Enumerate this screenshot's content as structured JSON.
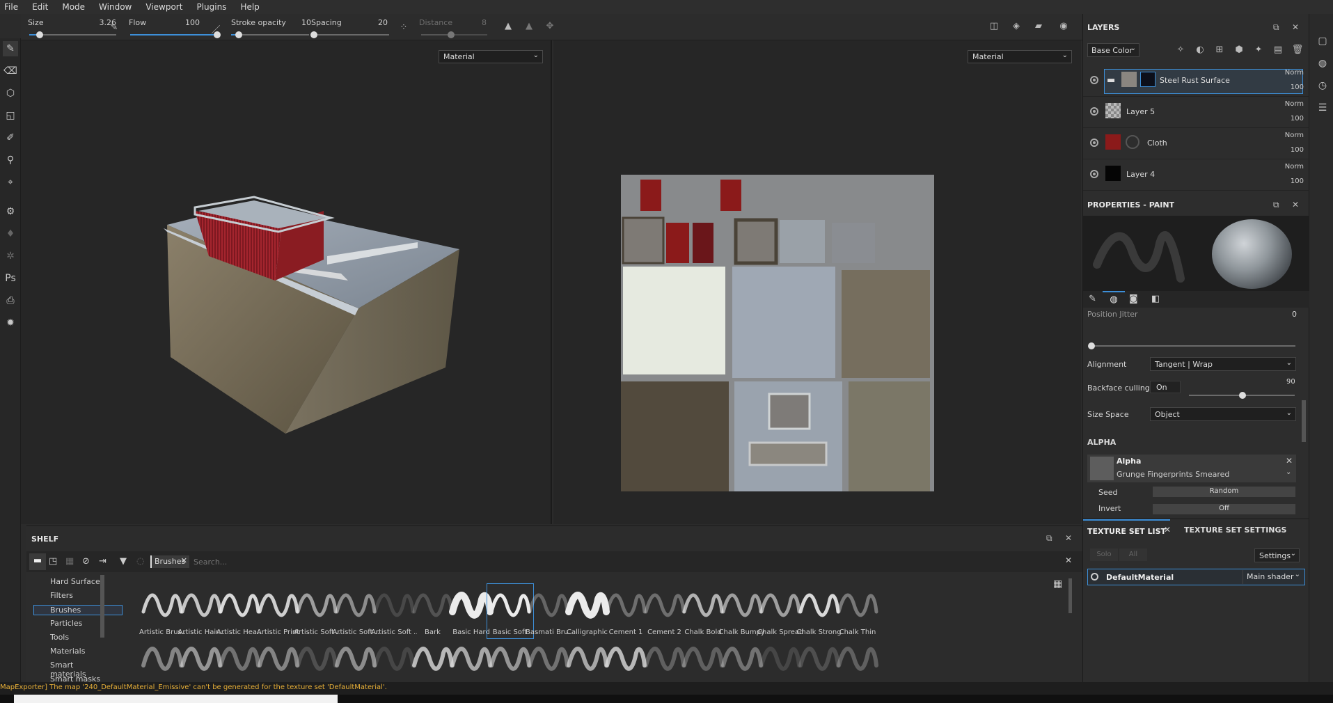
{
  "menu": [
    "File",
    "Edit",
    "Mode",
    "Window",
    "Viewport",
    "Plugins",
    "Help"
  ],
  "toolbar": {
    "size_label": "Size",
    "size_value": "3.26",
    "size_level": 0.12,
    "flow_label": "Flow",
    "flow_value": "100",
    "flow_level": 1.0,
    "stroke_opacity_label": "Stroke opacity",
    "stroke_opacity_value": "10",
    "stroke_opacity_level": 0.1,
    "spacing_label": "Spacing",
    "spacing_value": "20",
    "spacing_level": 0.04,
    "distance_label": "Distance",
    "distance_value": "8",
    "distance_level": 0.45
  },
  "viewport3d": {
    "mode": "Material"
  },
  "viewport2d": {
    "mode": "Material"
  },
  "layers": {
    "title": "LAYERS",
    "channel": "Base Color",
    "items": [
      {
        "name": "Steel Rust Surface",
        "blend": "Norm",
        "opacity": "100"
      },
      {
        "name": "Layer 5",
        "blend": "Norm",
        "opacity": "100"
      },
      {
        "name": "Cloth",
        "blend": "Norm",
        "opacity": "100"
      },
      {
        "name": "Layer 4",
        "blend": "Norm",
        "opacity": "100"
      }
    ]
  },
  "properties": {
    "title": "PROPERTIES - PAINT",
    "position_jitter_label": "Position Jitter",
    "position_jitter_value": "0",
    "alignment_label": "Alignment",
    "alignment_value": "Tangent | Wrap",
    "backface_label": "Backface culling",
    "backface_toggle": "On",
    "backface_value": "90",
    "size_space_label": "Size Space",
    "size_space_value": "Object",
    "alpha_section": "ALPHA",
    "alpha_title": "Alpha",
    "alpha_name": "Grunge Fingerprints Smeared",
    "seed_label": "Seed",
    "seed_value": "Random",
    "invert_label": "Invert",
    "invert_value": "Off"
  },
  "texture_set": {
    "tab_list": "TEXTURE SET LIST",
    "tab_settings": "TEXTURE SET SETTINGS",
    "solo": "Solo",
    "all": "All",
    "settings": "Settings",
    "material": "DefaultMaterial",
    "shader": "Main shader"
  },
  "shelf": {
    "title": "SHELF",
    "filter_chip": "Brushes",
    "search_placeholder": "Search...",
    "categories": [
      "Hard Surfaces",
      "Filters",
      "Brushes",
      "Particles",
      "Tools",
      "Materials",
      "Smart materials",
      "Smart masks"
    ],
    "selected_category": "Brushes",
    "brushes_row1": [
      "Artistic Brus...",
      "Artistic Hair...",
      "Artistic Hea...",
      "Artistic Print",
      "Artistic Soft ...",
      "Artistic Soft ...",
      "Artistic Soft ...",
      "Bark",
      "Basic Hard",
      "Basic Soft",
      "Basmati Bru...",
      "Calligraphic",
      "Cement 1",
      "Cement 2",
      "Chalk Bold",
      "Chalk Bumpy",
      "Chalk Spread",
      "Chalk Strong",
      "Chalk Thin"
    ],
    "selected_brush": "Basic Soft"
  },
  "status": {
    "message": "MapExporter] The map '240_DefaultMaterial_Emissive' can't be generated for the texture set 'DefaultMaterial'."
  },
  "colors": {
    "accent": "#3d8fd8",
    "warning": "#e8b038",
    "cloth_red": "#8b1a1a"
  }
}
